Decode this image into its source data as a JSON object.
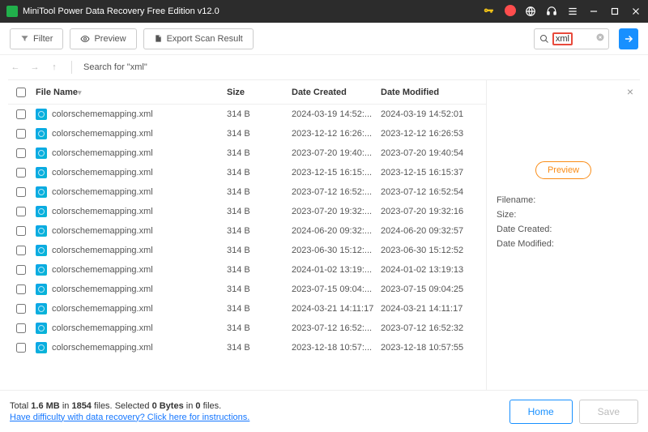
{
  "title": "MiniTool Power Data Recovery Free Edition v12.0",
  "toolbar": {
    "filter_label": "Filter",
    "preview_label": "Preview",
    "export_label": "Export Scan Result"
  },
  "search": {
    "value": "xml",
    "placeholder": ""
  },
  "nav": {
    "breadcrumb": "Search for  \"xml\""
  },
  "columns": {
    "name": "File Name",
    "size": "Size",
    "created": "Date Created",
    "modified": "Date Modified"
  },
  "rows": [
    {
      "name": "colorschememapping.xml",
      "size": "314 B",
      "created": "2024-03-19 14:52:...",
      "modified": "2024-03-19 14:52:01"
    },
    {
      "name": "colorschememapping.xml",
      "size": "314 B",
      "created": "2023-12-12 16:26:...",
      "modified": "2023-12-12 16:26:53"
    },
    {
      "name": "colorschememapping.xml",
      "size": "314 B",
      "created": "2023-07-20 19:40:...",
      "modified": "2023-07-20 19:40:54"
    },
    {
      "name": "colorschememapping.xml",
      "size": "314 B",
      "created": "2023-12-15 16:15:...",
      "modified": "2023-12-15 16:15:37"
    },
    {
      "name": "colorschememapping.xml",
      "size": "314 B",
      "created": "2023-07-12 16:52:...",
      "modified": "2023-07-12 16:52:54"
    },
    {
      "name": "colorschememapping.xml",
      "size": "314 B",
      "created": "2023-07-20 19:32:...",
      "modified": "2023-07-20 19:32:16"
    },
    {
      "name": "colorschememapping.xml",
      "size": "314 B",
      "created": "2024-06-20 09:32:...",
      "modified": "2024-06-20 09:32:57"
    },
    {
      "name": "colorschememapping.xml",
      "size": "314 B",
      "created": "2023-06-30 15:12:...",
      "modified": "2023-06-30 15:12:52"
    },
    {
      "name": "colorschememapping.xml",
      "size": "314 B",
      "created": "2024-01-02 13:19:...",
      "modified": "2024-01-02 13:19:13"
    },
    {
      "name": "colorschememapping.xml",
      "size": "314 B",
      "created": "2023-07-15 09:04:...",
      "modified": "2023-07-15 09:04:25"
    },
    {
      "name": "colorschememapping.xml",
      "size": "314 B",
      "created": "2024-03-21 14:11:17",
      "modified": "2024-03-21 14:11:17"
    },
    {
      "name": "colorschememapping.xml",
      "size": "314 B",
      "created": "2023-07-12 16:52:...",
      "modified": "2023-07-12 16:52:32"
    },
    {
      "name": "colorschememapping.xml",
      "size": "314 B",
      "created": "2023-12-18 10:57:...",
      "modified": "2023-12-18 10:57:55"
    }
  ],
  "side": {
    "preview_btn": "Preview",
    "filename_label": "Filename:",
    "size_label": "Size:",
    "created_label": "Date Created:",
    "modified_label": "Date Modified:"
  },
  "footer": {
    "total_prefix": "Total ",
    "total_size": "1.6 MB",
    "total_mid": " in ",
    "total_files": "1854",
    "total_suffix": " files.",
    "sel_prefix": "  Selected ",
    "sel_size": "0 Bytes",
    "sel_mid": " in ",
    "sel_files": "0",
    "sel_suffix": " files.",
    "help_link": "Have difficulty with data recovery? Click here for instructions.",
    "home_label": "Home",
    "save_label": "Save"
  }
}
